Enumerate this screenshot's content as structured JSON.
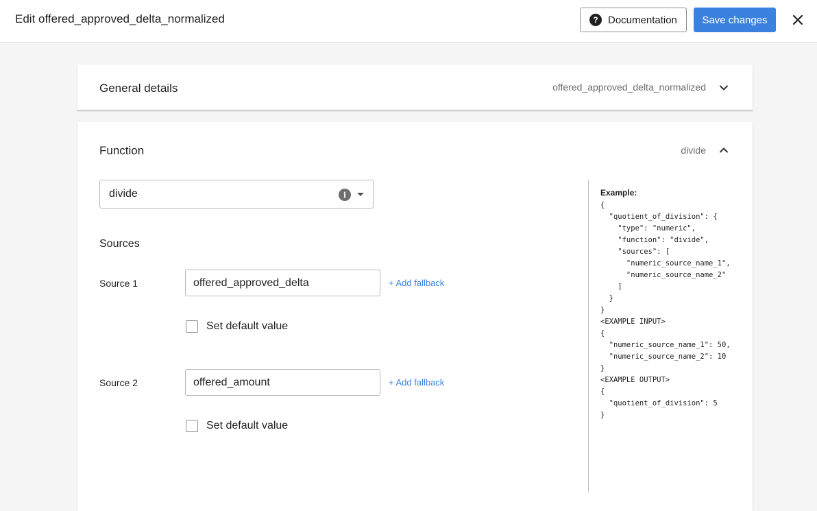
{
  "header": {
    "title": "Edit offered_approved_delta_normalized",
    "documentation_label": "Documentation",
    "save_label": "Save changes"
  },
  "general_details": {
    "title": "General details",
    "summary": "offered_approved_delta_normalized"
  },
  "function": {
    "title": "Function",
    "summary": "divide",
    "selected": "divide",
    "sources_title": "Sources",
    "sources": [
      {
        "label": "Source 1",
        "value": "offered_approved_delta",
        "fallback_label": "+  Add fallback",
        "default_label": "Set default value",
        "default_checked": false
      },
      {
        "label": "Source 2",
        "value": "offered_amount",
        "fallback_label": "+  Add fallback",
        "default_label": "Set default value",
        "default_checked": false
      }
    ],
    "example_title": "Example:",
    "example_code": "{\n  \"quotient_of_division\": {\n    \"type\": \"numeric\",\n    \"function\": \"divide\",\n    \"sources\": [\n      \"numeric_source_name_1\",\n      \"numeric_source_name_2\"\n    ]\n  }\n}\n<EXAMPLE INPUT>\n{\n  \"numeric_source_name_1\": 50,\n  \"numeric_source_name_2\": 10\n}\n<EXAMPLE OUTPUT>\n{\n  \"quotient_of_division\": 5\n}"
  },
  "icons": {
    "help": "help-circle-icon",
    "close": "close-icon",
    "expand": "chevron-down-icon",
    "collapse": "chevron-up-icon",
    "info": "info-icon",
    "dropdown": "caret-down-icon"
  },
  "colors": {
    "accent": "#3b82e0",
    "background": "#f5f5f5"
  }
}
